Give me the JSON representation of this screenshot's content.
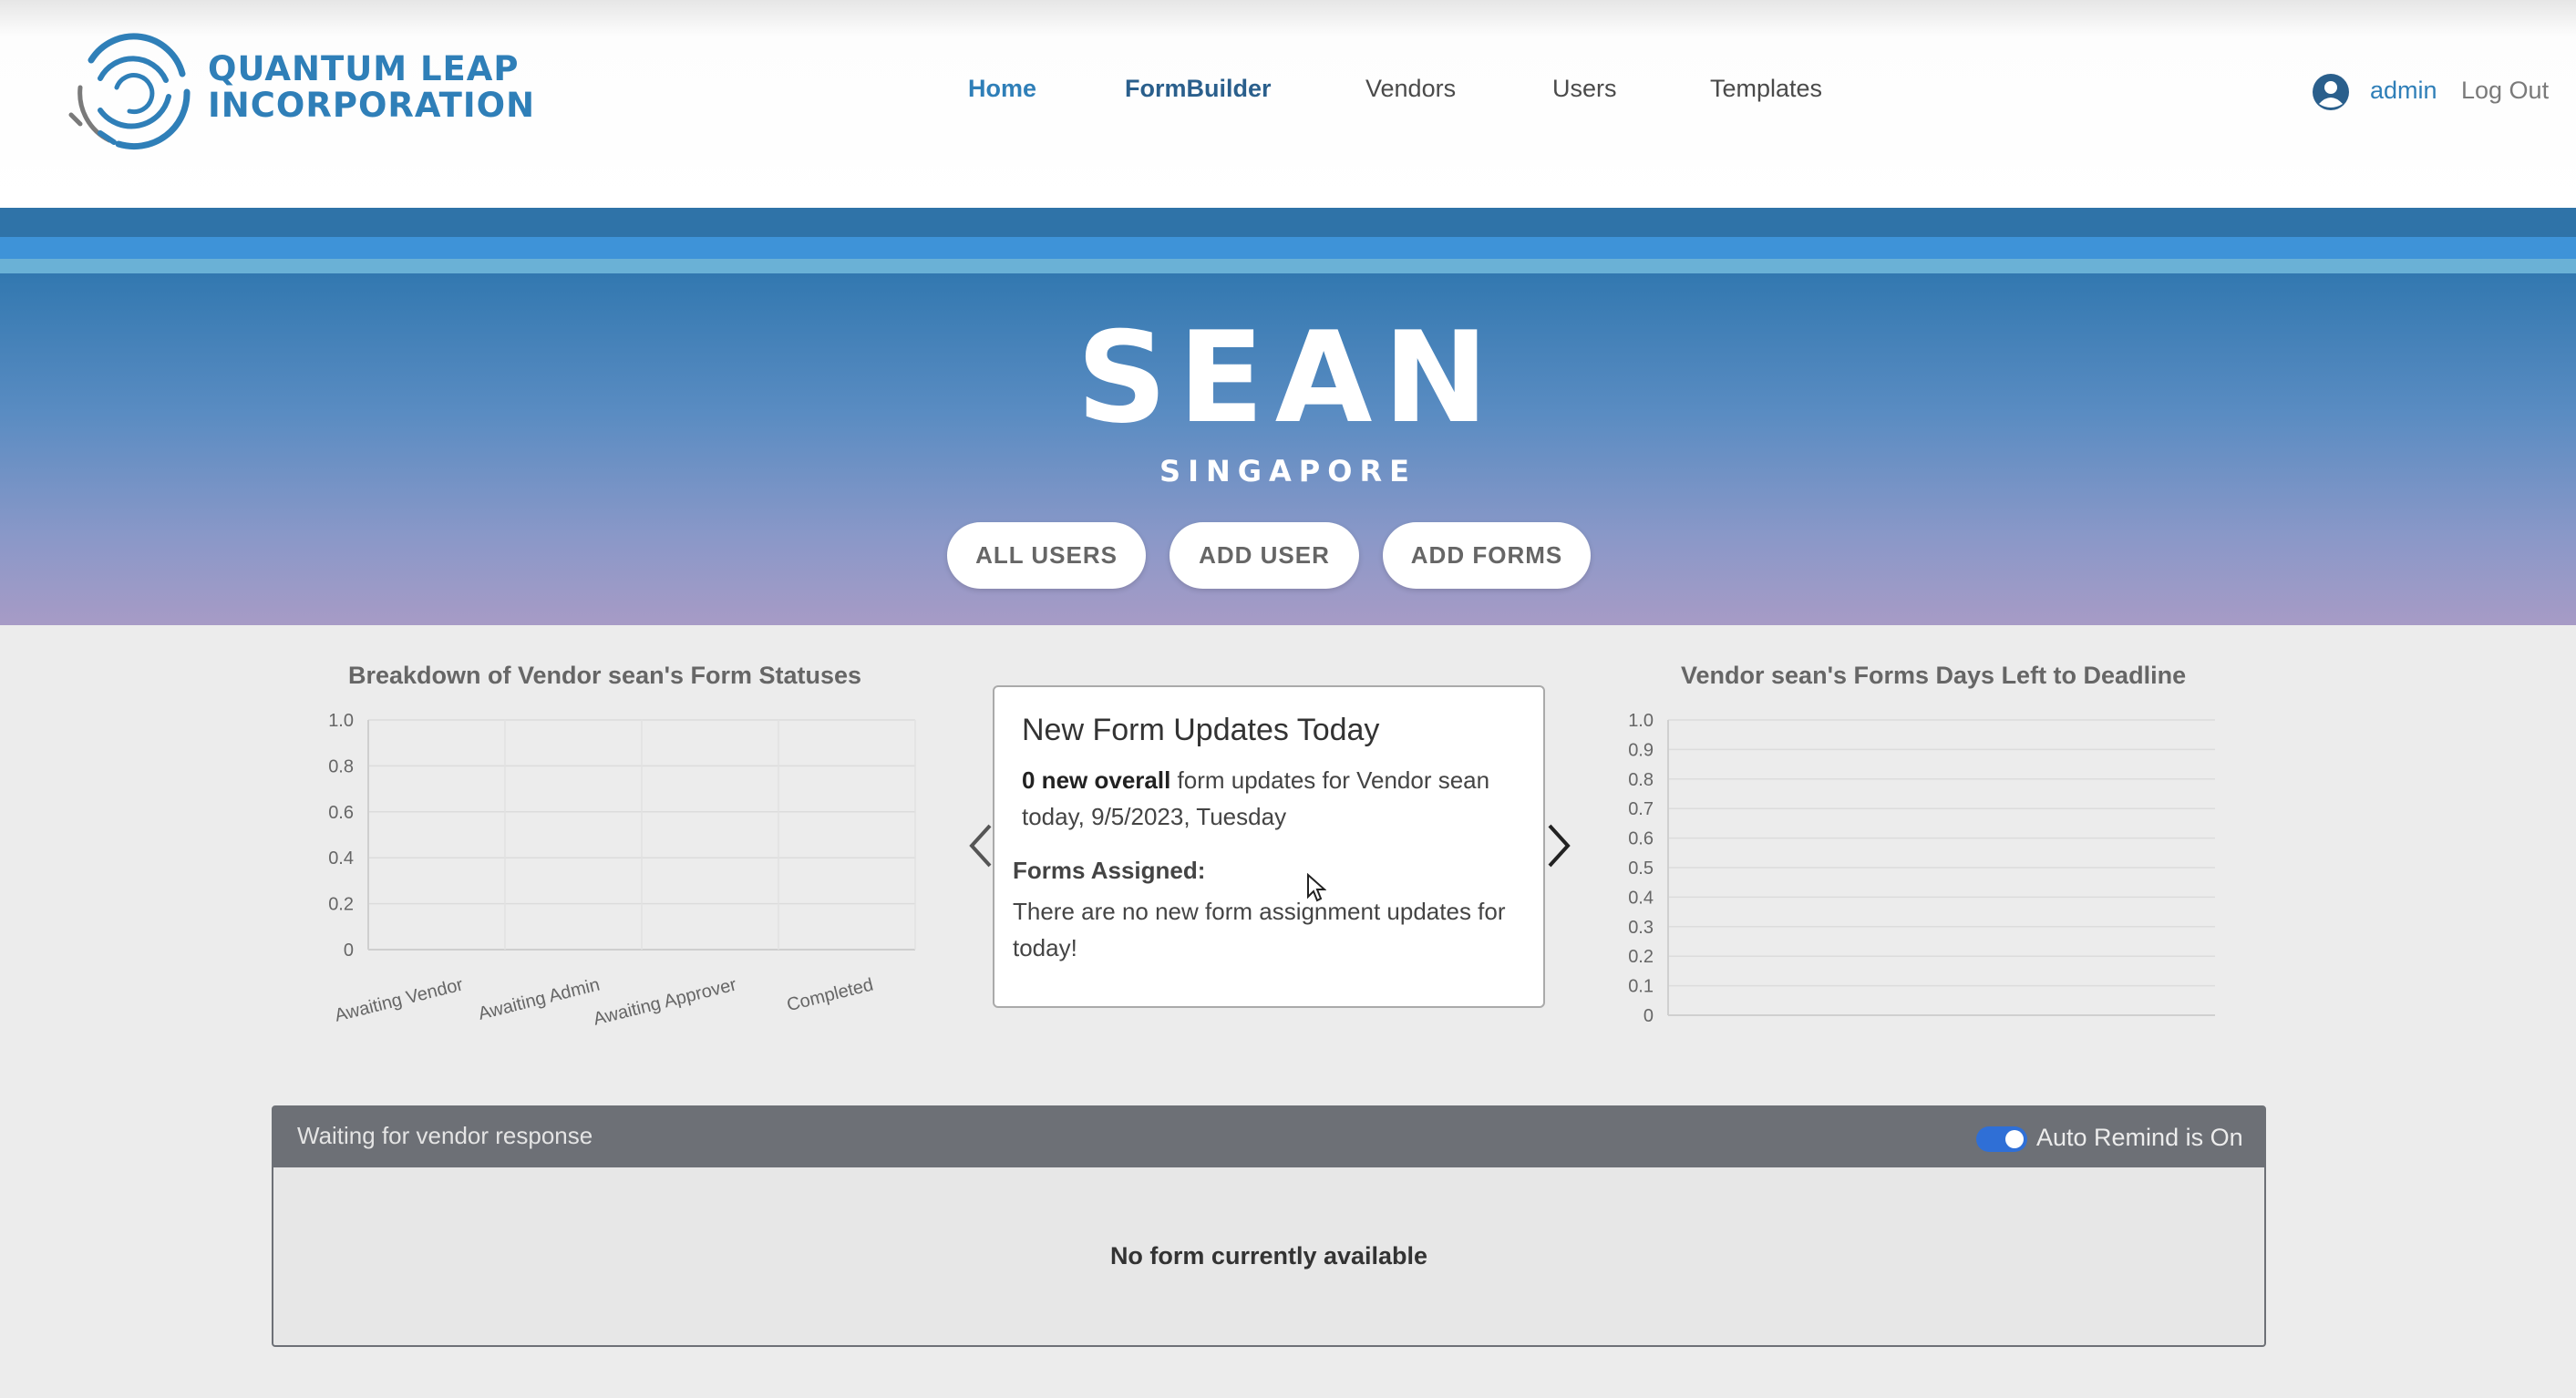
{
  "brand": {
    "line1": "QUANTUM LEAP",
    "line2": "INCORPORATION",
    "logo_icon": "concentric-rings-logo"
  },
  "nav": {
    "items": [
      {
        "label": "Home",
        "state": "active"
      },
      {
        "label": "FormBuilder",
        "state": "bold"
      },
      {
        "label": "Vendors",
        "state": "normal"
      },
      {
        "label": "Users",
        "state": "normal"
      },
      {
        "label": "Templates",
        "state": "normal"
      }
    ],
    "user_icon": "user-circle-icon",
    "user_label": "admin",
    "logout_label": "Log Out"
  },
  "hero": {
    "name": "SEAN",
    "location": "SINGAPORE",
    "buttons": {
      "all_users": "ALL USERS",
      "add_user": "ADD USER",
      "add_forms": "ADD FORMS"
    }
  },
  "chart_data": [
    {
      "type": "bar",
      "title": "Breakdown of Vendor sean's Form Statuses",
      "categories": [
        "Awaiting Vendor",
        "Awaiting Admin",
        "Awaiting Approver",
        "Completed"
      ],
      "values": [
        0,
        0,
        0,
        0
      ],
      "ylim": [
        0,
        1.0
      ],
      "yticks": [
        "0",
        "0.2",
        "0.4",
        "0.6",
        "0.8",
        "1.0"
      ],
      "grid": true
    },
    {
      "type": "bar",
      "title": "Vendor sean's Forms Days Left to Deadline",
      "categories": [],
      "values": [],
      "ylim": [
        0,
        1.0
      ],
      "yticks": [
        "0",
        "0.1",
        "0.2",
        "0.3",
        "0.4",
        "0.5",
        "0.6",
        "0.7",
        "0.8",
        "0.9",
        "1.0"
      ],
      "grid": true
    }
  ],
  "updates_card": {
    "title": "New Form Updates Today",
    "count_bold": "0 new overall",
    "count_rest": " form updates for Vendor sean today, 9/5/2023, Tuesday",
    "assigned_label": "Forms Assigned:",
    "assigned_text": "There are no new form assignment updates for today!",
    "prev_icon": "chevron-left-icon",
    "next_icon": "chevron-right-icon"
  },
  "vendor_panel": {
    "title": "Waiting for vendor response",
    "toggle_on": true,
    "toggle_label": "Auto Remind is On",
    "empty_message": "No form currently available"
  },
  "colors": {
    "accent": "#2f7fb8",
    "panel_header": "#6d7076",
    "toggle": "#2f6fd6"
  }
}
